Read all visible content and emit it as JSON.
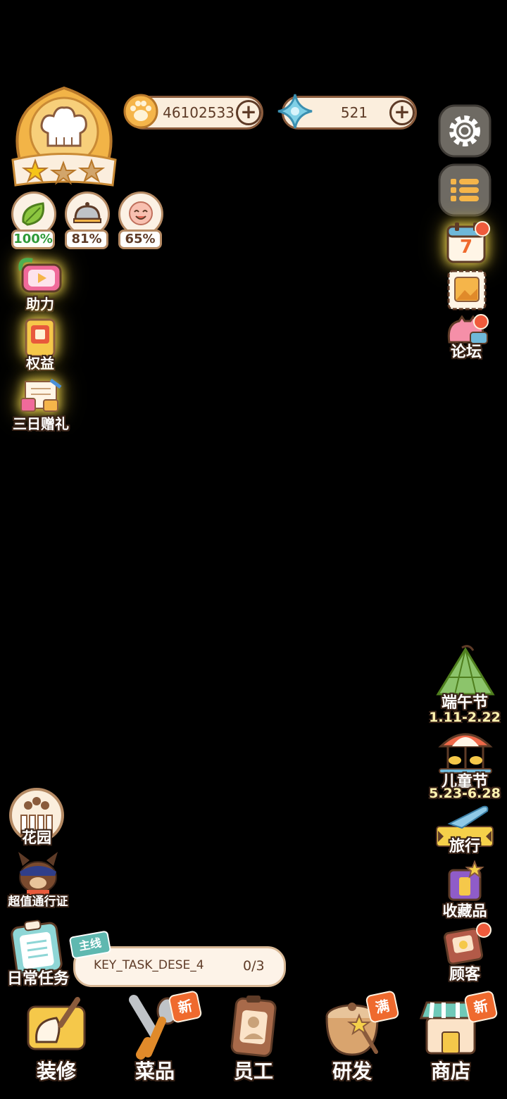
{
  "currency": {
    "coins": "46102533",
    "gems": "521"
  },
  "stats": [
    {
      "icon": "leaf-icon",
      "value": "100%",
      "color": "#2e9a3a"
    },
    {
      "icon": "cloche-icon",
      "value": "81%",
      "color": "#5e3b27"
    },
    {
      "icon": "smile-face-icon",
      "value": "65%",
      "color": "#5e3b27"
    }
  ],
  "left_menu": {
    "assist": "助力",
    "benefits": "权益",
    "three_day_gift": "三日赠礼"
  },
  "right_menu": {
    "calendar_day": "7",
    "forum": "论坛",
    "dragon_boat": "端午节",
    "dragon_boat_dates": "1.11-2.22",
    "childrens_day": "儿童节",
    "childrens_day_dates": "5.23-6.28",
    "travel": "旅行",
    "collectibles": "收藏品",
    "customers": "顾客"
  },
  "left_bottom": {
    "garden": "花园",
    "pass": "超值通行证",
    "daily_tasks": "日常任务"
  },
  "task": {
    "tag": "主线",
    "text": "KEY_TASK_DESE_4",
    "progress": "0/3"
  },
  "nav": [
    {
      "label": "装修",
      "badge": ""
    },
    {
      "label": "菜品",
      "badge": "新"
    },
    {
      "label": "员工",
      "badge": ""
    },
    {
      "label": "研发",
      "badge": "满"
    },
    {
      "label": "商店",
      "badge": "新"
    }
  ],
  "colors": {
    "accent": "#ef6a2e",
    "panel": "#fbeedd",
    "outline": "#5e3b27"
  }
}
